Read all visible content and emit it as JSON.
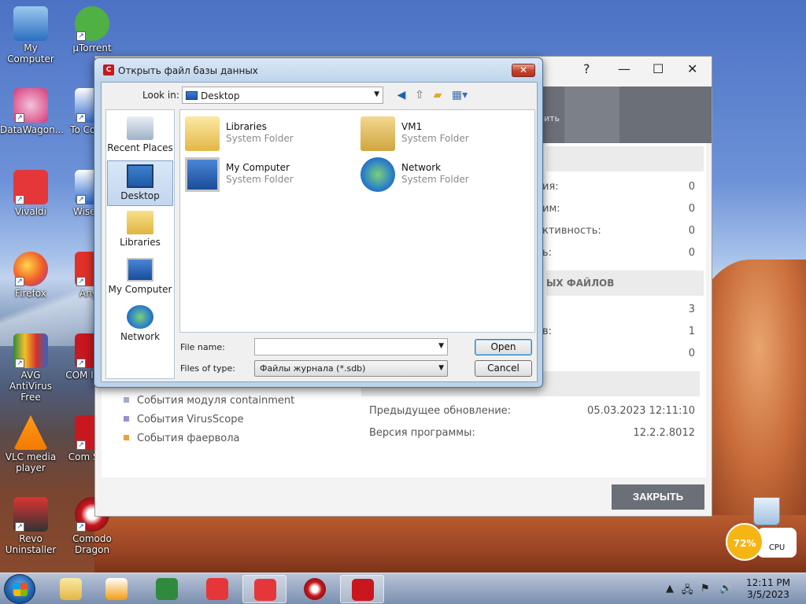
{
  "desktop": {
    "icons": [
      {
        "label": "My Computer"
      },
      {
        "label": "μTorrent"
      },
      {
        "label": "DataWagon..."
      },
      {
        "label": "To Comm"
      },
      {
        "label": "Vivaldi"
      },
      {
        "label": "Wise Ca"
      },
      {
        "label": "Firefox"
      },
      {
        "label": "AnyD"
      },
      {
        "label": "AVG AntiVirus Free"
      },
      {
        "label": "COM Intern"
      },
      {
        "label": "VLC media player"
      },
      {
        "label": "Com Secu"
      },
      {
        "label": "Revo Uninstaller"
      },
      {
        "label": "Comodo Dragon"
      }
    ]
  },
  "bg_window": {
    "controls": {
      "help": "?",
      "minimize": "—",
      "maximize": "☐",
      "close": "✕"
    },
    "tab_fragment": "ить",
    "rows_right": [
      {
        "label": "ия:",
        "value": "0"
      },
      {
        "label": "им:",
        "value": "0"
      },
      {
        "label": "ктивность:",
        "value": "0"
      },
      {
        "label": "ь:",
        "value": "0"
      }
    ],
    "section2": "ЫХ ФАЙЛОВ",
    "rows_right2": [
      {
        "label": "",
        "value": "3"
      },
      {
        "label": "в:",
        "value": "1"
      },
      {
        "label": "",
        "value": "0"
      }
    ],
    "legend": [
      {
        "label": "События модуля containment",
        "color": "#9fb0c8"
      },
      {
        "label": "События VirusScope",
        "color": "#9b8fd0"
      },
      {
        "label": "События фаервола",
        "color": "#e8a23c"
      }
    ],
    "info": [
      {
        "label": "Предыдущее обновление:",
        "value": "05.03.2023 12:11:10"
      },
      {
        "label": "Версия программы:",
        "value": "12.2.2.8012"
      }
    ],
    "close_label": "ЗАКРЫТЬ"
  },
  "dialog": {
    "title": "Открыть файл базы данных",
    "close": "✕",
    "look_in_label": "Look in:",
    "look_in_value": "Desktop",
    "places": [
      {
        "label": "Recent Places"
      },
      {
        "label": "Desktop"
      },
      {
        "label": "Libraries"
      },
      {
        "label": "My Computer"
      },
      {
        "label": "Network"
      }
    ],
    "files": [
      {
        "name": "Libraries",
        "type": "System Folder"
      },
      {
        "name": "VM1",
        "type": "System Folder"
      },
      {
        "name": "My Computer",
        "type": "System Folder"
      },
      {
        "name": "Network",
        "type": "System Folder"
      }
    ],
    "file_name_label": "File name:",
    "file_name_value": "",
    "files_of_type_label": "Files of type:",
    "files_of_type_value": "Файлы журнала (*.sdb)",
    "open_label": "Open",
    "cancel_label": "Cancel"
  },
  "gadget": {
    "percent": "72%",
    "label": "CPU"
  },
  "taskbar": {
    "time": "12:11 PM",
    "date": "3/5/2023"
  }
}
